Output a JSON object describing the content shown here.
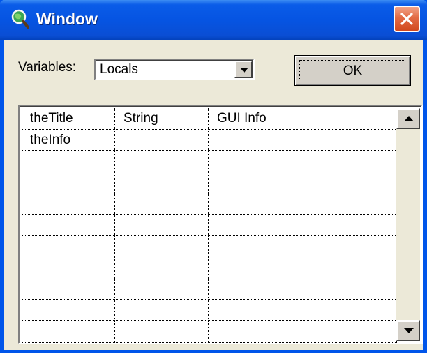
{
  "window": {
    "title": "Window",
    "icon": "magnifier-globe-icon",
    "titlebar_color": "#0654e2",
    "close_color": "#e26a44"
  },
  "variables": {
    "label": "Variables:",
    "selected": "Locals"
  },
  "ok_button": {
    "label": "OK"
  },
  "table": {
    "rows": [
      [
        "theTitle",
        "String",
        "GUI Info"
      ],
      [
        "theInfo",
        "",
        ""
      ],
      [
        "",
        "",
        ""
      ],
      [
        "",
        "",
        ""
      ],
      [
        "",
        "",
        ""
      ],
      [
        "",
        "",
        ""
      ],
      [
        "",
        "",
        ""
      ],
      [
        "",
        "",
        ""
      ],
      [
        "",
        "",
        ""
      ],
      [
        "",
        "",
        ""
      ],
      [
        "",
        "",
        ""
      ]
    ]
  }
}
